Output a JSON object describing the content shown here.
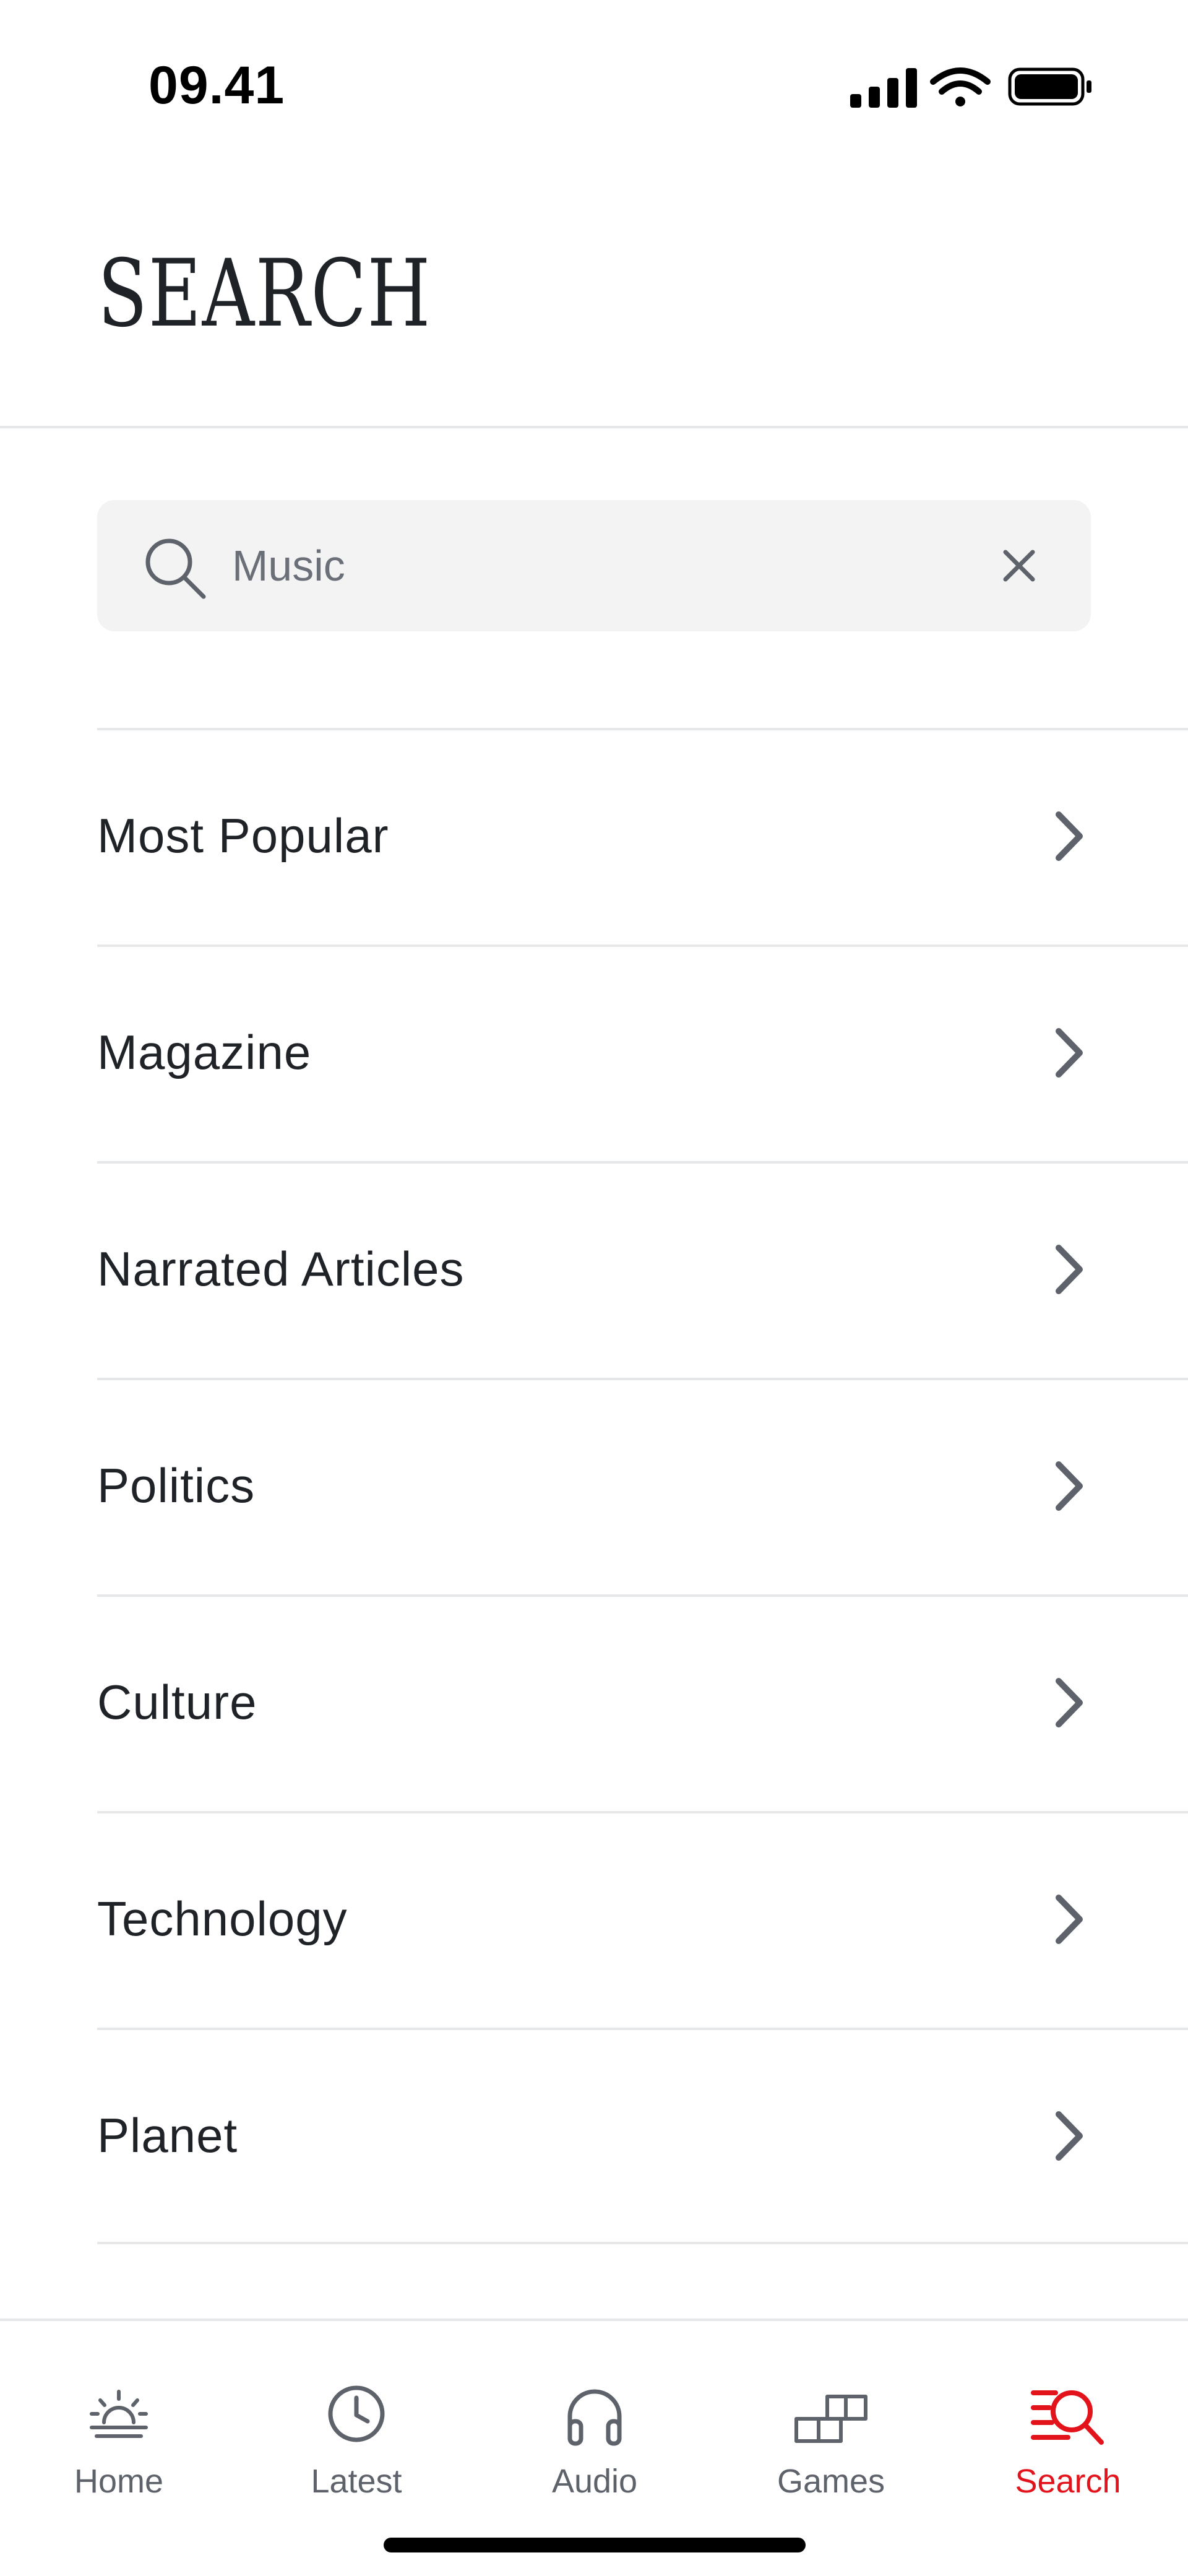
{
  "status_bar": {
    "time": "09.41",
    "icons": [
      "signal-icon",
      "wifi-icon",
      "battery-icon"
    ]
  },
  "header": {
    "title": "SEARCH"
  },
  "search": {
    "value": "Music",
    "icon": "search-icon",
    "clear_icon": "close-icon"
  },
  "menu": {
    "items": [
      {
        "label": "Most Popular"
      },
      {
        "label": "Magazine"
      },
      {
        "label": "Narrated Articles"
      },
      {
        "label": "Politics"
      },
      {
        "label": "Culture"
      },
      {
        "label": "Technology"
      },
      {
        "label": "Planet"
      }
    ]
  },
  "tabs": [
    {
      "label": "Home",
      "icon": "sunrise-icon",
      "active": false
    },
    {
      "label": "Latest",
      "icon": "clock-icon",
      "active": false
    },
    {
      "label": "Audio",
      "icon": "headphones-icon",
      "active": false
    },
    {
      "label": "Games",
      "icon": "blocks-icon",
      "active": false
    },
    {
      "label": "Search",
      "icon": "search-lines-icon",
      "active": true
    }
  ],
  "colors": {
    "accent": "#e3131b",
    "text": "#1f2328",
    "muted": "#5e636b",
    "divider": "#e6e7e9",
    "search_bg": "#f3f3f4"
  }
}
